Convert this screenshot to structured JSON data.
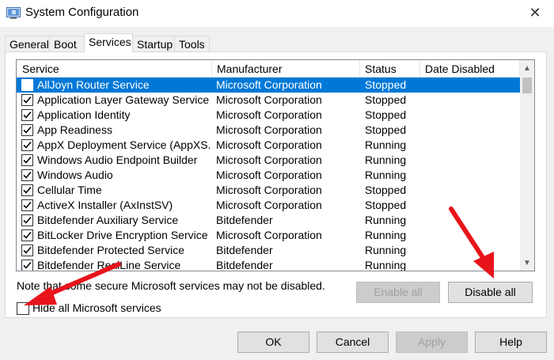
{
  "window": {
    "title": "System Configuration",
    "close_glyph": "✕",
    "icon": "msconfig-icon"
  },
  "tabs": [
    {
      "label": "General",
      "active": false
    },
    {
      "label": "Boot",
      "active": false
    },
    {
      "label": "Services",
      "active": true
    },
    {
      "label": "Startup",
      "active": false
    },
    {
      "label": "Tools",
      "active": false
    }
  ],
  "services_table": {
    "columns": [
      "Service",
      "Manufacturer",
      "Status",
      "Date Disabled"
    ],
    "rows": [
      {
        "service": "AllJoyn Router Service",
        "manufacturer": "Microsoft Corporation",
        "status": "Stopped",
        "date_disabled": "",
        "checked": true,
        "selected": true
      },
      {
        "service": "Application Layer Gateway Service",
        "manufacturer": "Microsoft Corporation",
        "status": "Stopped",
        "date_disabled": "",
        "checked": true,
        "selected": false
      },
      {
        "service": "Application Identity",
        "manufacturer": "Microsoft Corporation",
        "status": "Stopped",
        "date_disabled": "",
        "checked": true,
        "selected": false
      },
      {
        "service": "App Readiness",
        "manufacturer": "Microsoft Corporation",
        "status": "Stopped",
        "date_disabled": "",
        "checked": true,
        "selected": false
      },
      {
        "service": "AppX Deployment Service (AppXS...",
        "manufacturer": "Microsoft Corporation",
        "status": "Running",
        "date_disabled": "",
        "checked": true,
        "selected": false
      },
      {
        "service": "Windows Audio Endpoint Builder",
        "manufacturer": "Microsoft Corporation",
        "status": "Running",
        "date_disabled": "",
        "checked": true,
        "selected": false
      },
      {
        "service": "Windows Audio",
        "manufacturer": "Microsoft Corporation",
        "status": "Running",
        "date_disabled": "",
        "checked": true,
        "selected": false
      },
      {
        "service": "Cellular Time",
        "manufacturer": "Microsoft Corporation",
        "status": "Stopped",
        "date_disabled": "",
        "checked": true,
        "selected": false
      },
      {
        "service": "ActiveX Installer (AxInstSV)",
        "manufacturer": "Microsoft Corporation",
        "status": "Stopped",
        "date_disabled": "",
        "checked": true,
        "selected": false
      },
      {
        "service": "Bitdefender Auxiliary Service",
        "manufacturer": "Bitdefender",
        "status": "Running",
        "date_disabled": "",
        "checked": true,
        "selected": false
      },
      {
        "service": "BitLocker Drive Encryption Service",
        "manufacturer": "Microsoft Corporation",
        "status": "Running",
        "date_disabled": "",
        "checked": true,
        "selected": false
      },
      {
        "service": "Bitdefender Protected Service",
        "manufacturer": "Bitdefender",
        "status": "Running",
        "date_disabled": "",
        "checked": true,
        "selected": false
      },
      {
        "service": "Bitdefender RealLine Service",
        "manufacturer": "Bitdefender",
        "status": "Running",
        "date_disabled": "",
        "checked": true,
        "selected": false
      }
    ]
  },
  "note": "Note that some secure Microsoft services may not be disabled.",
  "buttons": {
    "enable_all": "Enable all",
    "disable_all": "Disable all",
    "ok": "OK",
    "cancel": "Cancel",
    "apply": "Apply",
    "help": "Help"
  },
  "hide_ms_services": {
    "label": "Hide all Microsoft services",
    "checked": false
  },
  "annotation_color": "#e8141b",
  "selection_color": "#0078d7"
}
